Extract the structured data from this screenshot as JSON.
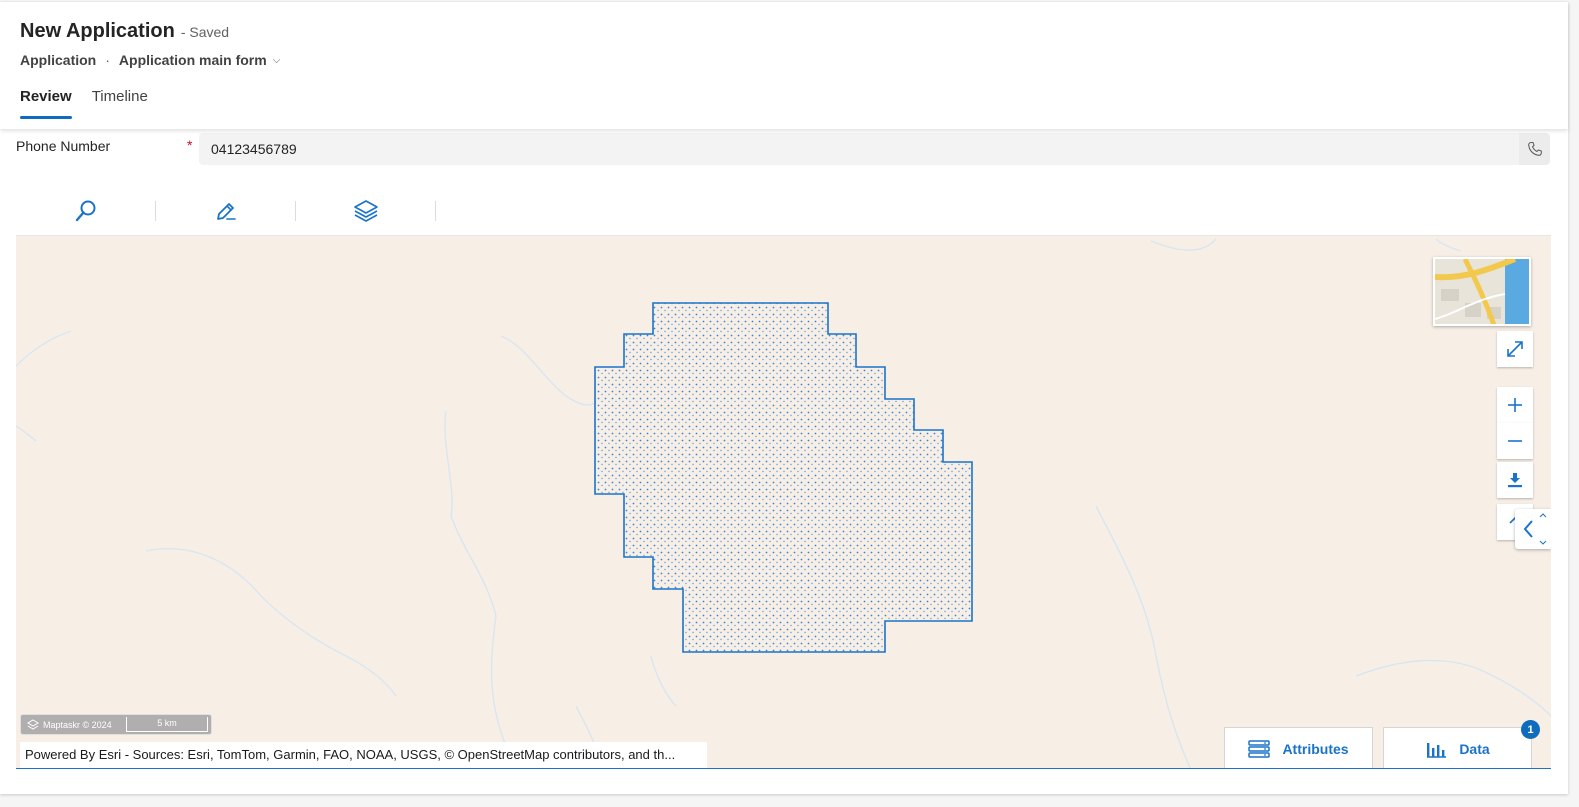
{
  "header": {
    "title": "New Application",
    "status": "- Saved",
    "breadcrumb_entity": "Application",
    "breadcrumb_separator": "·",
    "breadcrumb_form": "Application main form",
    "breadcrumb_chevron": "⌵"
  },
  "tabs": [
    {
      "label": "Review",
      "active": true
    },
    {
      "label": "Timeline",
      "active": false
    }
  ],
  "phone_field": {
    "label": "Phone Number",
    "required_marker": "*",
    "value": "04123456789"
  },
  "map": {
    "toolbar": [
      "search-icon",
      "pencil-icon",
      "layers-icon"
    ],
    "scalebar": {
      "brand": "Maptaskr © 2024",
      "distance": "5 km"
    },
    "attribution": "Powered By Esri - Sources: Esri, TomTom, Garmin, FAO, NOAA, USGS, © OpenStreetMap contributors, and th...",
    "controls": [
      "basemap-thumbnail",
      "fullscreen-icon",
      "zoom-in-icon",
      "zoom-out-icon",
      "download-icon",
      "collapse-icon"
    ],
    "bottom_buttons": {
      "attributes_label": "Attributes",
      "data_label": "Data",
      "data_badge": "1"
    },
    "colors": {
      "background": "#f7efe6",
      "polygon_stroke": "#1a73c8",
      "polygon_dots": "#3a86d6",
      "streams": "#d8e6f2",
      "accent": "#0f6cbd"
    }
  }
}
